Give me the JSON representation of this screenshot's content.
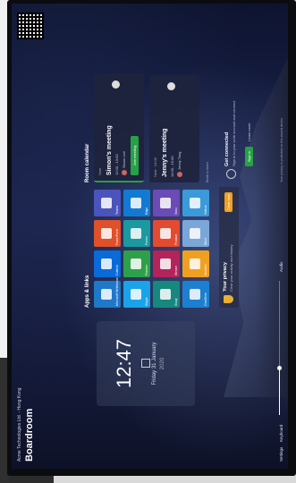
{
  "header": {
    "company": "Acme Technologies Ltd. - Hong Kong",
    "room_name": "Boardroom"
  },
  "clock": {
    "time": "12:47",
    "date": "Friday 31 January",
    "year": "2020"
  },
  "apps": {
    "title": "Apps & links",
    "tiles": [
      {
        "label": "Microsoft Whiteboard",
        "color": "#1f78c8",
        "icon": "whiteboard-icon"
      },
      {
        "label": "Outlook",
        "color": "#0a6ad8",
        "icon": "outlook-icon"
      },
      {
        "label": "PowerPoint",
        "color": "#e0502a",
        "icon": "powerpoint-icon"
      },
      {
        "label": "Teams",
        "color": "#4b53bc",
        "icon": "teams-icon"
      },
      {
        "label": "Skype",
        "color": "#1aa3e8",
        "icon": "skype-icon"
      },
      {
        "label": "Planner",
        "color": "#2fa04a",
        "icon": "planner-icon"
      },
      {
        "label": "Forms",
        "color": "#1a9aa0",
        "icon": "forms-icon"
      },
      {
        "label": "Edge",
        "color": "#137ad3",
        "icon": "edge-icon"
      },
      {
        "label": "Sway",
        "color": "#17887f",
        "icon": "sway-icon"
      },
      {
        "label": "Stream",
        "color": "#b3245b",
        "icon": "stream-icon"
      },
      {
        "label": "Product",
        "color": "#e24b2f",
        "icon": "product-icon"
      },
      {
        "label": "Xbox",
        "color": "#6b4bb5",
        "icon": "xbox-icon"
      },
      {
        "label": "OneDrive",
        "color": "#1d7fd0",
        "icon": "onedrive-icon"
      },
      {
        "label": "Weather",
        "color": "#f0a020",
        "icon": "weather-icon"
      },
      {
        "label": "Store",
        "color": "#7aa7d8",
        "icon": "store-icon"
      },
      {
        "label": "Videos",
        "color": "#3b9ad9",
        "icon": "videos-icon"
      }
    ]
  },
  "privacy": {
    "title": "Your privacy",
    "subtitle": "Clear your activity and history",
    "button": "Clear now"
  },
  "calendar": {
    "title": "Room calendar",
    "meetings": [
      {
        "state": "Now",
        "name": "Simon's meeting",
        "when": "12:00 - 13:00",
        "who": "Simon Lee",
        "join": "Join meeting"
      },
      {
        "state": "Next · 14:00",
        "name": "Jenny's meeting",
        "when": "14:00 - 15:00",
        "who": "Jenny Tang",
        "join": ""
      }
    ],
    "more": "Book a room"
  },
  "connect": {
    "title": "Get connected",
    "subtitle": "Sign in to your work account and connect",
    "sign_in": "Sign in",
    "learn": "Learn more"
  },
  "bottom": {
    "settings": "Settings",
    "keyboard": "Keyboard",
    "audio": "Audio",
    "footnote": "Your privacy is protected on this shared device"
  }
}
